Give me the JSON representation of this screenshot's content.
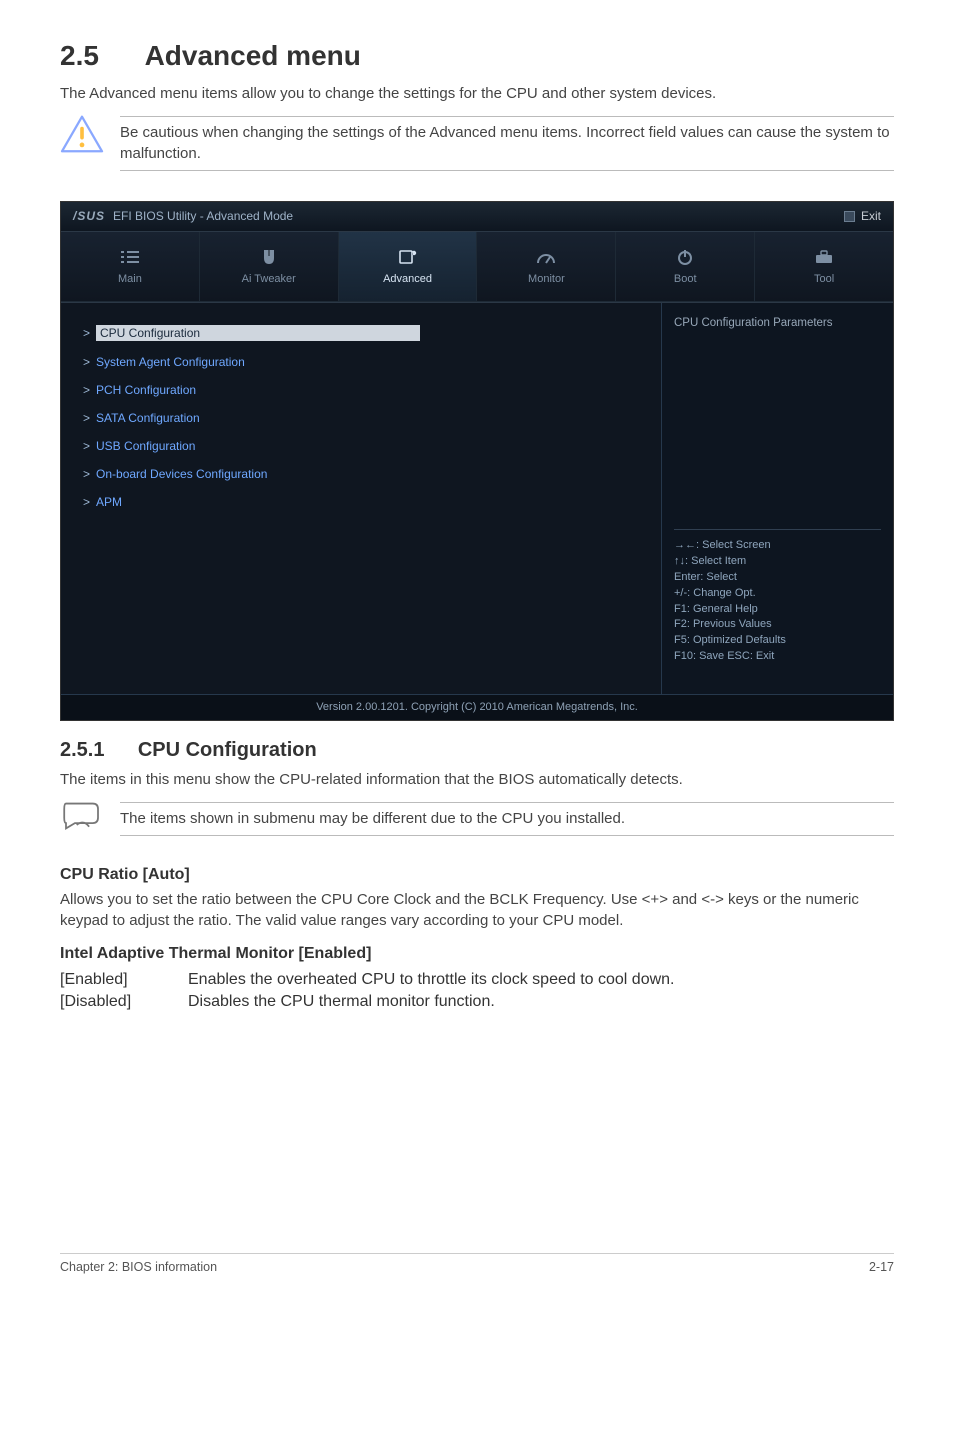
{
  "section_no": "2.5",
  "section_title": "Advanced menu",
  "intro": "The Advanced menu items allow you to change the settings for the CPU and other system devices.",
  "warning": "Be cautious when changing the settings of the Advanced menu items. Incorrect field values can cause the system to malfunction.",
  "bios": {
    "brand": "/SUS",
    "title": "EFI BIOS Utility - Advanced Mode",
    "exit": "Exit",
    "tabs": {
      "main": "Main",
      "ai_tweaker": "Ai Tweaker",
      "advanced": "Advanced",
      "monitor": "Monitor",
      "boot": "Boot",
      "tool": "Tool"
    },
    "menu": {
      "cpu": "CPU Configuration",
      "sys_agent": "System Agent Configuration",
      "pch": "PCH Configuration",
      "sata": "SATA Configuration",
      "usb": "USB Configuration",
      "onboard": "On-board Devices Configuration",
      "apm": "APM"
    },
    "right_caption": "CPU Configuration Parameters",
    "hints": {
      "l1": "→←: Select Screen",
      "l2": "↑↓: Select Item",
      "l3": "Enter: Select",
      "l4": "+/-: Change Opt.",
      "l5": "F1: General Help",
      "l6": "F2: Previous Values",
      "l7": "F5: Optimized Defaults",
      "l8": "F10: Save   ESC: Exit"
    },
    "footer": "Version 2.00.1201. Copyright (C) 2010 American Megatrends, Inc."
  },
  "sub_no": "2.5.1",
  "sub_title": "CPU Configuration",
  "sub_intro": "The items in this menu show the CPU-related information that the BIOS automatically detects.",
  "note": "The items shown in submenu may be different due to the CPU you installed.",
  "cpu_ratio_heading": "CPU Ratio [Auto]",
  "cpu_ratio_body": "Allows you to set the ratio between the CPU Core Clock and the BCLK Frequency. Use <+> and <-> keys or the numeric keypad to adjust the ratio. The valid value ranges vary according to your CPU model.",
  "iatm_heading": "Intel Adaptive Thermal Monitor [Enabled]",
  "iatm": {
    "enabled_key": "[Enabled]",
    "enabled_val": "Enables the overheated CPU to throttle its clock speed to cool down.",
    "disabled_key": "[Disabled]",
    "disabled_val": "Disables the CPU thermal monitor function."
  },
  "footer_left": "Chapter 2: BIOS information",
  "footer_right": "2-17"
}
